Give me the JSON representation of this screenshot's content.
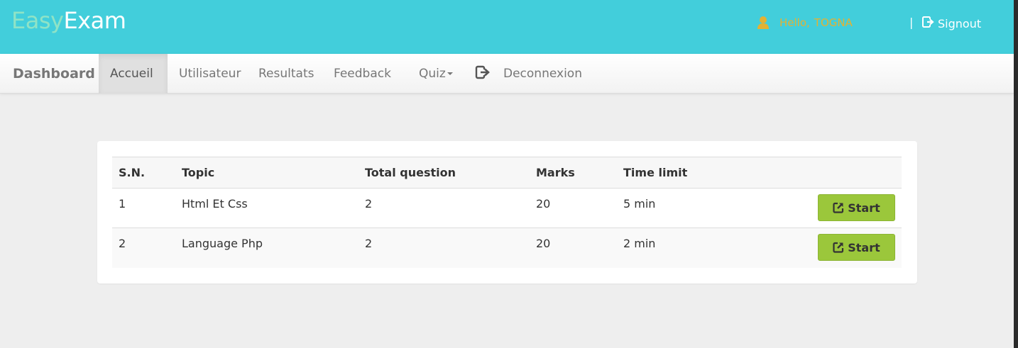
{
  "header": {
    "logo_part1": "Easy",
    "logo_part2": "Exam",
    "greeting": "Hello,",
    "username": "TOGNA",
    "separator": "|",
    "signout_label": "Signout"
  },
  "nav": {
    "brand": "Dashboard",
    "items": [
      {
        "label": "Accueil"
      },
      {
        "label": "Utilisateur"
      },
      {
        "label": "Resultats"
      },
      {
        "label": "Feedback"
      },
      {
        "label": "Quiz"
      },
      {
        "label": "Deconnexion"
      }
    ]
  },
  "table": {
    "headers": [
      "S.N.",
      "Topic",
      "Total question",
      "Marks",
      "Time limit"
    ],
    "rows": [
      {
        "sn": "1",
        "topic": "Html Et Css",
        "total_question": "2",
        "marks": "20",
        "time_limit": "5 min",
        "action": "Start"
      },
      {
        "sn": "2",
        "topic": "Language Php",
        "total_question": "2",
        "marks": "20",
        "time_limit": "2 min",
        "action": "Start"
      }
    ]
  },
  "colors": {
    "header_bg": "#42cedb",
    "logo_easy": "#8fe3c6",
    "greeting": "#e3b233",
    "start_button": "#9bc73b"
  },
  "icons": {
    "user": "user-icon",
    "signout": "signout-icon",
    "logout": "logout-icon",
    "start": "external-link-icon"
  }
}
